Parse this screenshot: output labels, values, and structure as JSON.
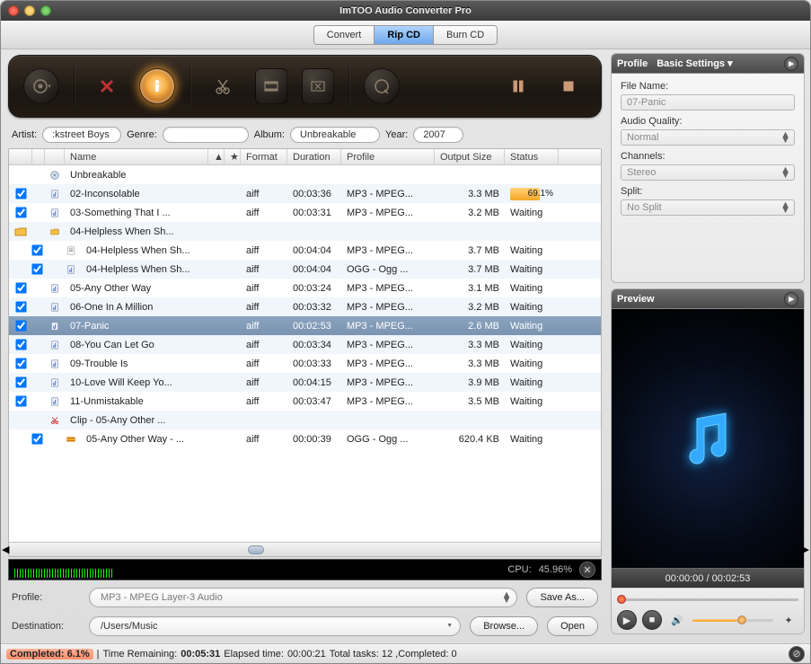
{
  "title": "ImTOO Audio Converter Pro",
  "tabs": {
    "convert": "Convert",
    "rip": "Rip CD",
    "burn": "Burn CD",
    "active": "rip"
  },
  "meta": {
    "artist_label": "Artist:",
    "artist_value": ":kstreet Boys",
    "genre_label": "Genre:",
    "genre_value": "",
    "album_label": "Album:",
    "album_value": "Unbreakable",
    "year_label": "Year:",
    "year_value": "2007"
  },
  "columns": {
    "name": "Name",
    "format": "Format",
    "duration": "Duration",
    "profile": "Profile",
    "output": "Output Size",
    "status": "Status"
  },
  "tracks": [
    {
      "chk": false,
      "indent": 0,
      "icon": "cd",
      "name": "Unbreakable",
      "fmt": "",
      "dur": "",
      "prof": "",
      "out": "",
      "stat": ""
    },
    {
      "chk": true,
      "indent": 0,
      "icon": "audio",
      "name": "02-Inconsolable",
      "fmt": "aiff",
      "dur": "00:03:36",
      "prof": "MP3 - MPEG...",
      "out": "3.3 MB",
      "stat": "69.1%",
      "progress": 69.1
    },
    {
      "chk": true,
      "indent": 0,
      "icon": "audio",
      "name": "03-Something That I ...",
      "fmt": "aiff",
      "dur": "00:03:31",
      "prof": "MP3 - MPEG...",
      "out": "3.2 MB",
      "stat": "Waiting"
    },
    {
      "chk": false,
      "indent": 0,
      "icon": "folder",
      "name": "04-Helpless When Sh...",
      "fmt": "",
      "dur": "",
      "prof": "",
      "out": "",
      "stat": ""
    },
    {
      "chk": true,
      "indent": 1,
      "icon": "doc",
      "name": "04-Helpless When Sh...",
      "fmt": "aiff",
      "dur": "00:04:04",
      "prof": "MP3 - MPEG...",
      "out": "3.7 MB",
      "stat": "Waiting"
    },
    {
      "chk": true,
      "indent": 1,
      "icon": "audio",
      "name": "04-Helpless When Sh...",
      "fmt": "aiff",
      "dur": "00:04:04",
      "prof": "OGG - Ogg ...",
      "out": "3.7 MB",
      "stat": "Waiting"
    },
    {
      "chk": true,
      "indent": 0,
      "icon": "audio",
      "name": "05-Any Other Way",
      "fmt": "aiff",
      "dur": "00:03:24",
      "prof": "MP3 - MPEG...",
      "out": "3.1 MB",
      "stat": "Waiting"
    },
    {
      "chk": true,
      "indent": 0,
      "icon": "audio",
      "name": "06-One In A Million",
      "fmt": "aiff",
      "dur": "00:03:32",
      "prof": "MP3 - MPEG...",
      "out": "3.2 MB",
      "stat": "Waiting"
    },
    {
      "chk": true,
      "indent": 0,
      "icon": "audio",
      "name": "07-Panic",
      "fmt": "aiff",
      "dur": "00:02:53",
      "prof": "MP3 - MPEG...",
      "out": "2.6 MB",
      "stat": "Waiting",
      "selected": true
    },
    {
      "chk": true,
      "indent": 0,
      "icon": "audio",
      "name": "08-You Can Let Go",
      "fmt": "aiff",
      "dur": "00:03:34",
      "prof": "MP3 - MPEG...",
      "out": "3.3 MB",
      "stat": "Waiting"
    },
    {
      "chk": true,
      "indent": 0,
      "icon": "audio",
      "name": "09-Trouble Is",
      "fmt": "aiff",
      "dur": "00:03:33",
      "prof": "MP3 - MPEG...",
      "out": "3.3 MB",
      "stat": "Waiting"
    },
    {
      "chk": true,
      "indent": 0,
      "icon": "audio",
      "name": "10-Love Will Keep Yo...",
      "fmt": "aiff",
      "dur": "00:04:15",
      "prof": "MP3 - MPEG...",
      "out": "3.9 MB",
      "stat": "Waiting"
    },
    {
      "chk": true,
      "indent": 0,
      "icon": "audio",
      "name": "11-Unmistakable",
      "fmt": "aiff",
      "dur": "00:03:47",
      "prof": "MP3 - MPEG...",
      "out": "3.5 MB",
      "stat": "Waiting"
    },
    {
      "chk": false,
      "indent": 0,
      "icon": "clip",
      "name": "Clip - 05-Any Other ...",
      "fmt": "",
      "dur": "",
      "prof": "",
      "out": "",
      "stat": ""
    },
    {
      "chk": true,
      "indent": 1,
      "icon": "strip",
      "name": "05-Any Other Way - ...",
      "fmt": "aiff",
      "dur": "00:00:39",
      "prof": "OGG - Ogg ...",
      "out": "620.4 KB",
      "stat": "Waiting"
    }
  ],
  "cpu": {
    "label": "CPU:",
    "value": "45.96%"
  },
  "lower": {
    "profile_label": "Profile:",
    "profile_value": "MP3 - MPEG Layer-3 Audio",
    "saveas": "Save As...",
    "dest_label": "Destination:",
    "dest_value": "/Users/Music",
    "browse": "Browse...",
    "open": "Open"
  },
  "status": {
    "completed_lbl": "Completed:",
    "completed_pct": "6.1%",
    "tr_lbl": "Time Remaining:",
    "tr_val": "00:05:31",
    "el_lbl": "Elapsed time:",
    "el_val": "00:00:21",
    "tasks": "Total tasks: 12 ,Completed: 0"
  },
  "profile_panel": {
    "title": "Profile",
    "settings": "Basic Settings",
    "filename_lbl": "File Name:",
    "filename_val": "07-Panic",
    "aq_lbl": "Audio Quality:",
    "aq_val": "Normal",
    "ch_lbl": "Channels:",
    "ch_val": "Stereo",
    "sp_lbl": "Split:",
    "sp_val": "No Split"
  },
  "preview": {
    "title": "Preview",
    "time": "00:00:00 / 00:02:53"
  }
}
